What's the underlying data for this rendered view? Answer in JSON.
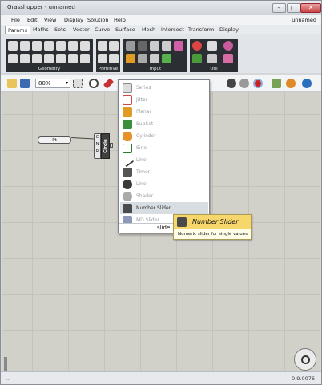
{
  "window": {
    "title": "Grasshopper - unnamed",
    "minimize": "–",
    "maximize": "□",
    "close": "✕"
  },
  "menu": {
    "items": [
      "File",
      "Edit",
      "View",
      "Display",
      "Solution",
      "Help"
    ],
    "doc_name": "unnamed"
  },
  "tabs": [
    "Params",
    "Maths",
    "Sets",
    "Vector",
    "Curve",
    "Surface",
    "Mesh",
    "Intersect",
    "Transform",
    "Display"
  ],
  "ribbon": {
    "groups": [
      "Geometry",
      "Primitive",
      "Input",
      "Util"
    ]
  },
  "toolbar": {
    "zoom": "80%",
    "zoom_arrow": "▾"
  },
  "canvas": {
    "point_node_label": "Pt",
    "circle_inputs": [
      "C",
      "N",
      "R"
    ],
    "circle_label": "Circle"
  },
  "popup": {
    "items": [
      "Series",
      "Jitter",
      "Planar",
      "SubSet",
      "Cylinder",
      "Sine",
      "Line",
      "Timer",
      "Line",
      "Shader",
      "Number Slider",
      "MD Slider"
    ],
    "search": "slide"
  },
  "tooltip": {
    "title": "Number Slider",
    "description": "Numeric slider for single values"
  },
  "status": {
    "left": "...",
    "version": "0.9.0076",
    "resize": "⋰"
  },
  "colors": {
    "canvas": "#d2d1c9",
    "tooltip_head": "#f7d76c",
    "ribbon_group": "#2b2e32"
  }
}
